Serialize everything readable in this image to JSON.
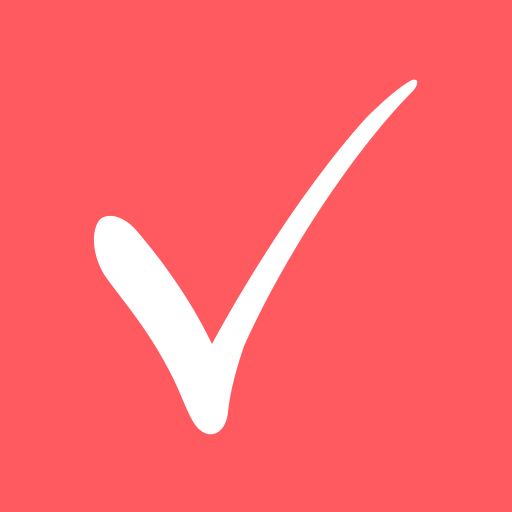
{
  "icon": {
    "name": "checkmark-icon",
    "background_color": "#FF5A5F",
    "foreground_color": "#FFFFFF"
  }
}
